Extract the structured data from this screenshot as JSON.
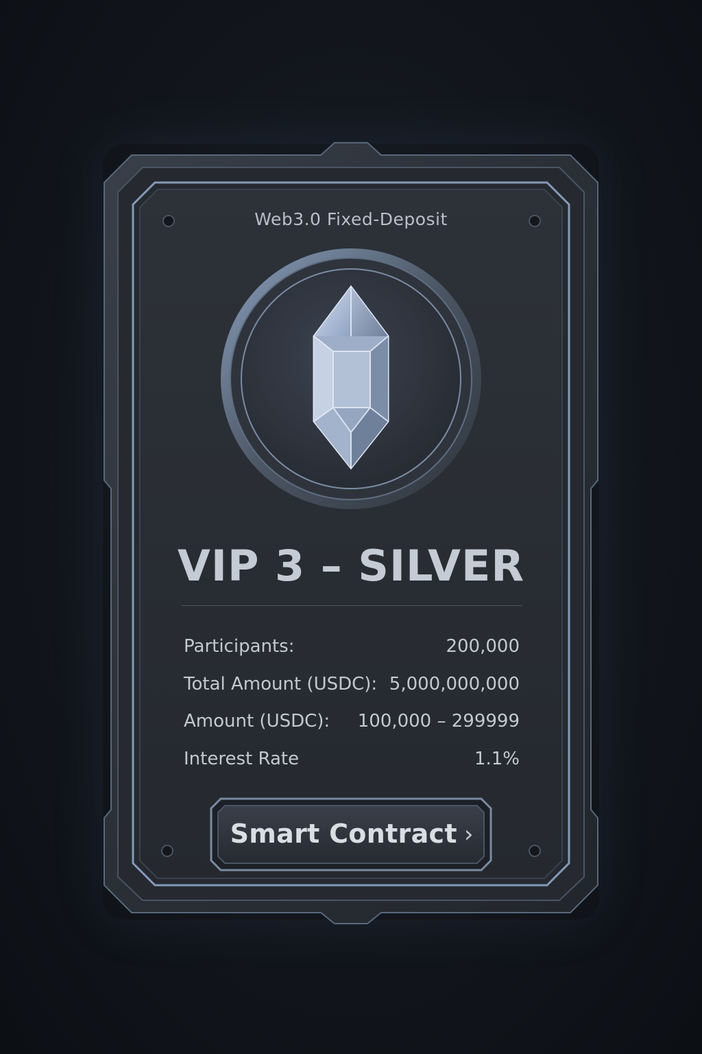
{
  "card": {
    "header": "Web3.0 Fixed-Deposit",
    "tier_title": "VIP 3 – SILVER",
    "emblem_icon": "crystal-gem-icon",
    "stats": [
      {
        "label": "Participants:",
        "value": "200,000"
      },
      {
        "label": "Total Amount (USDC):",
        "value": "5,000,000,000"
      },
      {
        "label": "Amount (USDC):",
        "value": "100,000 – 299999"
      },
      {
        "label": "Interest Rate",
        "value": "1.1%"
      }
    ],
    "cta": {
      "label": "Smart Contract",
      "icon": "chevron-right-icon",
      "chevron": "›"
    }
  },
  "colors": {
    "background": "#101319",
    "card_face": "#2a2e35",
    "frame_edge": "#8fa6c6",
    "text_primary": "#c4cbd4",
    "accent_glow": "#5a82c8"
  }
}
